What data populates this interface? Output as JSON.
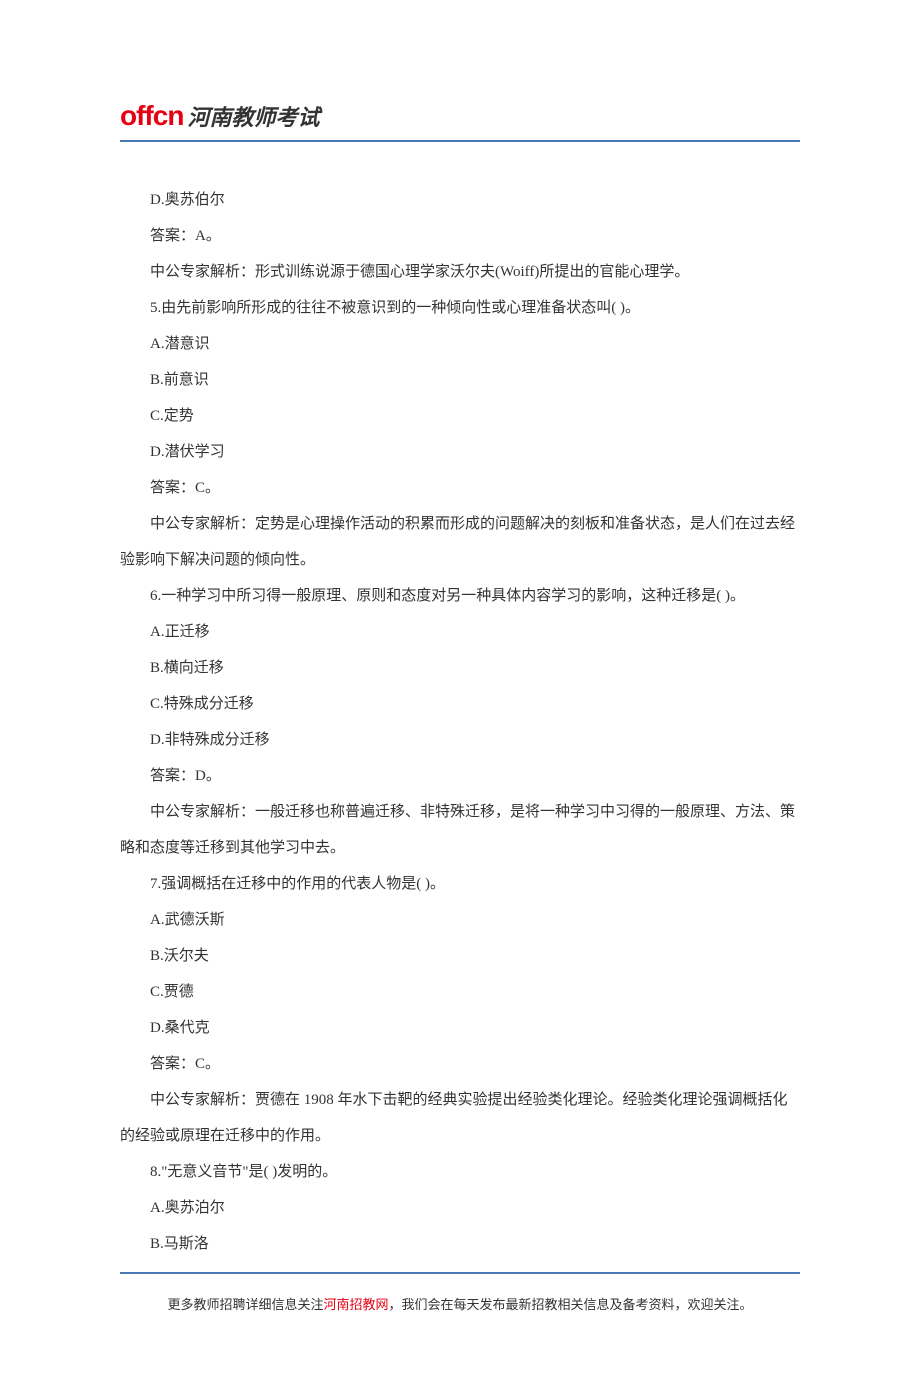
{
  "header": {
    "logo_brand": "offcn",
    "logo_suffix": "河南教师考试"
  },
  "content": {
    "lines": [
      "D.奥苏伯尔",
      "答案：A。",
      "中公专家解析：形式训练说源于德国心理学家沃尔夫(Woiff)所提出的官能心理学。",
      "5.由先前影响所形成的往往不被意识到的一种倾向性或心理准备状态叫( )。",
      "A.潜意识",
      "B.前意识",
      "C.定势",
      "D.潜伏学习",
      "答案：C。",
      "中公专家解析：定势是心理操作活动的积累而形成的问题解决的刻板和准备状态，是人们在过去经验影响下解决问题的倾向性。",
      "6.一种学习中所习得一般原理、原则和态度对另一种具体内容学习的影响，这种迁移是( )。",
      "A.正迁移",
      "B.横向迁移",
      "C.特殊成分迁移",
      "D.非特殊成分迁移",
      "答案：D。",
      "中公专家解析：一般迁移也称普遍迁移、非特殊迁移，是将一种学习中习得的一般原理、方法、策略和态度等迁移到其他学习中去。",
      "7.强调概括在迁移中的作用的代表人物是( )。",
      "A.武德沃斯",
      "B.沃尔夫",
      "C.贾德",
      "D.桑代克",
      "答案：C。",
      "中公专家解析：贾德在 1908 年水下击靶的经典实验提出经验类化理论。经验类化理论强调概括化的经验或原理在迁移中的作用。",
      "8.\"无意义音节\"是( )发明的。",
      "A.奥苏泊尔",
      "B.马斯洛"
    ]
  },
  "footer": {
    "prefix": "更多教师招聘详细信息关注",
    "highlight": "河南招教网",
    "suffix": "，我们会在每天发布最新招教相关信息及备考资料，欢迎关注。"
  }
}
